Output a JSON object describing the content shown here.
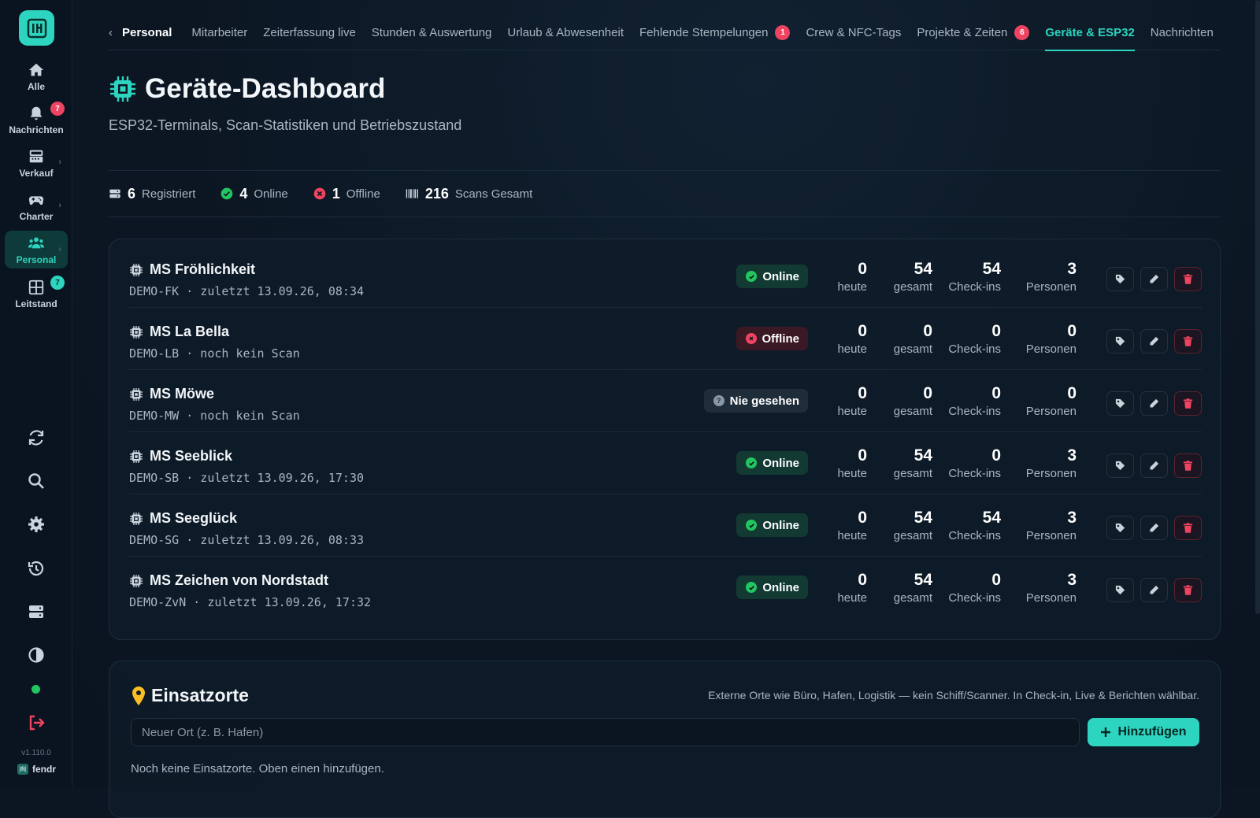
{
  "sidebar": {
    "logo_icon": "fendr-logo-icon",
    "items": [
      {
        "label": "Alle",
        "icon": "home-icon"
      },
      {
        "label": "Nachrichten",
        "icon": "bell-icon",
        "badge": "7",
        "badge_color": "#ef4461"
      },
      {
        "label": "Verkauf",
        "icon": "register-icon",
        "chevron": "›"
      },
      {
        "label": "Charter",
        "icon": "gamepad-icon",
        "chevron": "›"
      },
      {
        "label": "Personal",
        "icon": "users-icon",
        "chevron": "›",
        "active": true
      },
      {
        "label": "Leitstand",
        "icon": "grid-icon",
        "badge": "7",
        "badge_color": "#2dd4bf"
      }
    ],
    "tools": [
      "refresh-icon",
      "search-icon",
      "gear-icon",
      "history-icon",
      "server-icon",
      "contrast-icon",
      "logout-icon"
    ],
    "version": "v1.110.0",
    "brand": "fendr",
    "brand_mark": "|fi|"
  },
  "topnav": {
    "back_chevron": "‹",
    "back_label": "Personal",
    "tabs": [
      {
        "label": "Mitarbeiter"
      },
      {
        "label": "Zeiterfassung live"
      },
      {
        "label": "Stunden & Auswertung"
      },
      {
        "label": "Urlaub & Abwesenheit"
      },
      {
        "label": "Fehlende Stempelungen",
        "badge": "1"
      },
      {
        "label": "Crew & NFC-Tags"
      },
      {
        "label": "Projekte & Zeiten",
        "badge": "6"
      },
      {
        "label": "Geräte & ESP32",
        "active": true
      },
      {
        "label": "Nachrichten"
      }
    ]
  },
  "header": {
    "title": "Geräte-Dashboard",
    "subtitle": "ESP32-Terminals, Scan-Statistiken und Betriebszustand"
  },
  "stats": [
    {
      "value": "6",
      "label": "Registriert",
      "icon": "server-icon"
    },
    {
      "value": "4",
      "label": "Online",
      "icon": "check-circle-icon"
    },
    {
      "value": "1",
      "label": "Offline",
      "icon": "x-circle-icon"
    },
    {
      "value": "216",
      "label": "Scans Gesamt",
      "icon": "barcode-icon"
    }
  ],
  "metric_labels": {
    "today": "heute",
    "total": "gesamt",
    "checkins": "Check-ins",
    "persons": "Personen"
  },
  "devices": [
    {
      "name": "MS Fröhlichkeit",
      "sub": "DEMO-FK · zuletzt 13.09.26, 08:34",
      "status": "Online",
      "status_type": "online",
      "today": "0",
      "total": "54",
      "checkins": "54",
      "persons": "3"
    },
    {
      "name": "MS La Bella",
      "sub": "DEMO-LB · noch kein Scan",
      "status": "Offline",
      "status_type": "offline",
      "today": "0",
      "total": "0",
      "checkins": "0",
      "persons": "0"
    },
    {
      "name": "MS Möwe",
      "sub": "DEMO-MW · noch kein Scan",
      "status": "Nie gesehen",
      "status_type": "never",
      "today": "0",
      "total": "0",
      "checkins": "0",
      "persons": "0"
    },
    {
      "name": "MS Seeblick",
      "sub": "DEMO-SB · zuletzt 13.09.26, 17:30",
      "status": "Online",
      "status_type": "online",
      "today": "0",
      "total": "54",
      "checkins": "0",
      "persons": "3"
    },
    {
      "name": "MS Seeglück",
      "sub": "DEMO-SG · zuletzt 13.09.26, 08:33",
      "status": "Online",
      "status_type": "online",
      "today": "0",
      "total": "54",
      "checkins": "54",
      "persons": "3"
    },
    {
      "name": "MS Zeichen von Nordstadt",
      "sub": "DEMO-ZvN · zuletzt 13.09.26, 17:32",
      "status": "Online",
      "status_type": "online",
      "today": "0",
      "total": "54",
      "checkins": "0",
      "persons": "3"
    }
  ],
  "locations": {
    "title": "Einsatzorte",
    "hint": "Externe Orte wie Büro, Hafen, Logistik — kein Schiff/Scanner. In Check-in, Live & Berichten wählbar.",
    "input_placeholder": "Neuer Ort (z. B. Hafen)",
    "input_value": "",
    "add_label": "Hinzufügen",
    "empty": "Noch keine Einsatzorte. Oben einen hinzufügen."
  },
  "colors": {
    "accent": "#2dd4bf",
    "danger": "#ef4461",
    "online": "#22c55e",
    "warning": "#fbbf24"
  }
}
